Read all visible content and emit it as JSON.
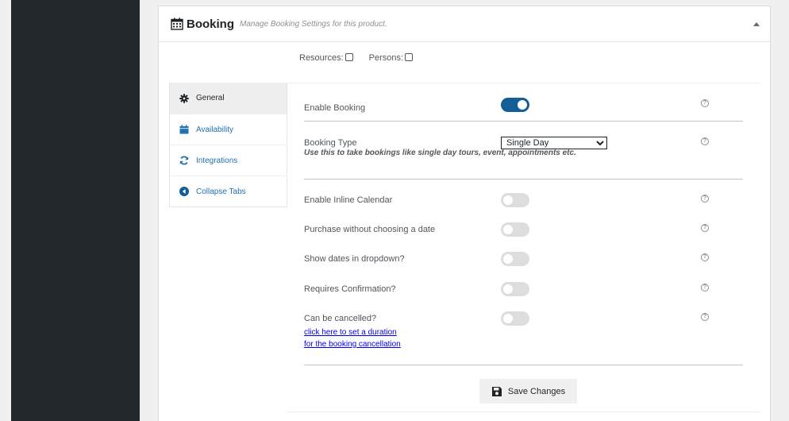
{
  "panel": {
    "title": "Booking",
    "subtitle": "Manage Booking Settings for this product."
  },
  "options": {
    "resources_label": "Resources:",
    "persons_label": "Persons:"
  },
  "tabs": [
    {
      "label": "General",
      "icon": "gear-icon"
    },
    {
      "label": "Availability",
      "icon": "calendar-icon"
    },
    {
      "label": "Integrations",
      "icon": "refresh-icon"
    },
    {
      "label": "Collapse Tabs",
      "icon": "collapse-left-icon"
    }
  ],
  "settings": {
    "enable_booking": {
      "label": "Enable Booking",
      "on": true
    },
    "booking_type": {
      "label": "Booking Type",
      "selected": "Single Day",
      "note": "Use this to take bookings like single day tours, event, appointments etc."
    },
    "inline_calendar": {
      "label": "Enable Inline Calendar",
      "on": false
    },
    "purchase_without_date": {
      "label": "Purchase without choosing a date",
      "on": false
    },
    "dates_dropdown": {
      "label": "Show dates in dropdown?",
      "on": false
    },
    "requires_confirmation": {
      "label": "Requires Confirmation?",
      "on": false
    },
    "can_be_cancelled": {
      "label": "Can be cancelled?",
      "on": false,
      "link_line1": "click here to set a duration",
      "link_line2": "for the booking cancellation"
    }
  },
  "help_glyph": "?",
  "save_label": "Save Changes",
  "colors": {
    "accent": "#135e96",
    "link": "#2271b1",
    "sidebar": "#23282d"
  }
}
